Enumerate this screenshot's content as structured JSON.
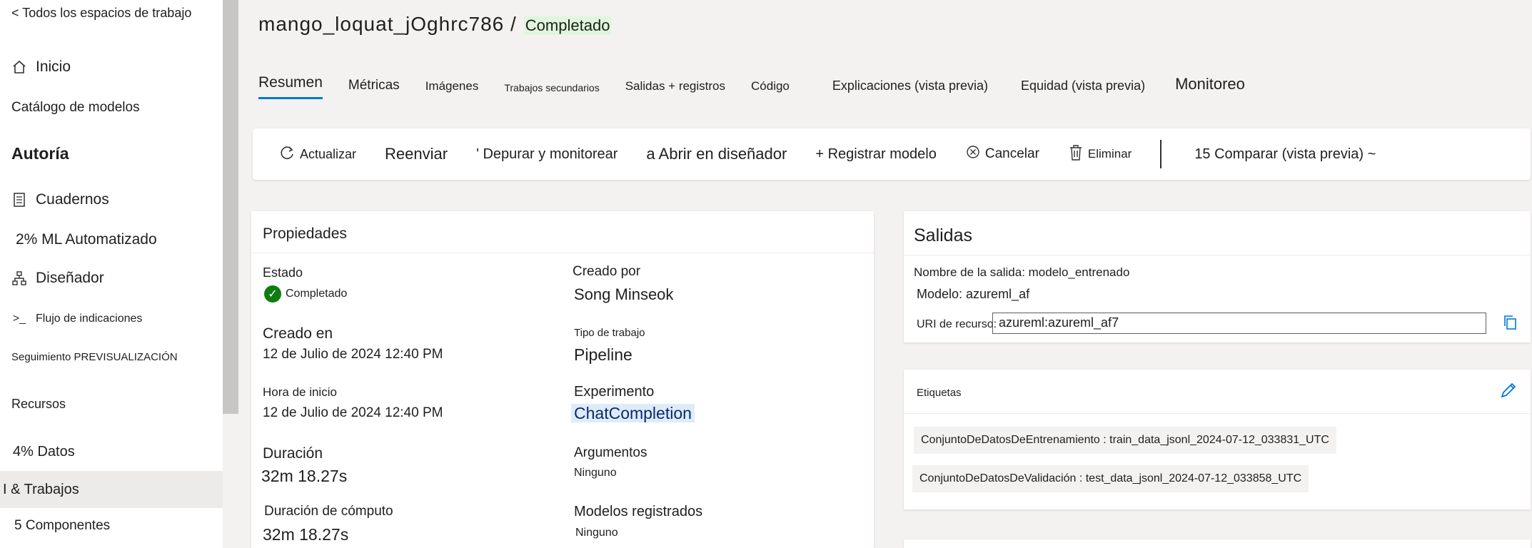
{
  "sidebar": {
    "back": "< Todos los espacios de trabajo",
    "home": "Inicio",
    "catalog": "Catálogo de modelos",
    "authoring": "Autoría",
    "notebooks": "Cuadernos",
    "automl": "2% ML Automatizado",
    "designer": "Diseñador",
    "promptflow": "Flujo de indicaciones",
    "tracking": "Seguimiento PREVISUALIZACIÓN",
    "resources": "Recursos",
    "data": "4% Datos",
    "jobs": "I & Trabajos",
    "components": "5 Componentes"
  },
  "header": {
    "title": "mango_loquat_jOghrc786 /",
    "status": "Completado"
  },
  "tabs": [
    {
      "label": "Resumen"
    },
    {
      "label": "Métricas"
    },
    {
      "label": "Imágenes"
    },
    {
      "label": "Trabajos secundarios"
    },
    {
      "label": "Salidas + registros"
    },
    {
      "label": "Código"
    },
    {
      "label": "Explicaciones (vista previa)"
    },
    {
      "label": "Equidad (vista previa)"
    },
    {
      "label": "Monitoreo"
    }
  ],
  "toolbar": {
    "refresh": "Actualizar",
    "resubmit": "Reenviar",
    "debug": "' Depurar y monitorear",
    "open_designer": "a Abrir en diseñador",
    "register": "+ Registrar modelo",
    "cancel": "Cancelar",
    "delete": "Eliminar",
    "compare": "15 Comparar (vista previa) ~"
  },
  "properties": {
    "title": "Propiedades",
    "status_label": "Estado",
    "status_value": "Completado",
    "created_by_label": "Creado por",
    "created_by_value": "Song Minseok",
    "created_at_label": "Creado en",
    "created_at_value": "12 de Julio de 2024 12:40 PM",
    "job_type_label": "Tipo de trabajo",
    "job_type_value": "Pipeline",
    "start_label": "Hora de inicio",
    "start_value": "12 de Julio de 2024 12:40 PM",
    "experiment_label": "Experimento",
    "experiment_value": "ChatCompletion",
    "duration_label": "Duración",
    "duration_value": "32m 18.27s",
    "args_label": "Argumentos",
    "args_value": "Ninguno",
    "compute_label": "Duración de cómputo",
    "compute_value": "32m 18.27s",
    "models_label": "Modelos registrados",
    "models_value": "Ninguno"
  },
  "outputs": {
    "title": "Salidas",
    "output_name": "Nombre de la salida: modelo_entrenado",
    "model": "Modelo: azureml_af",
    "uri_label": "URI de recurso:",
    "uri_value": "azureml:azureml_af7"
  },
  "tags": {
    "title": "Etiquetas",
    "items": [
      "ConjuntoDeDatosDeEntrenamiento : train_data_jsonl_2024-07-12_033831_UTC",
      "ConjuntoDeDatosDeValidación : test_data_jsonl_2024-07-12_033858_UTC"
    ]
  },
  "colors": {
    "accent": "#0078d4",
    "success": "#107c10"
  }
}
